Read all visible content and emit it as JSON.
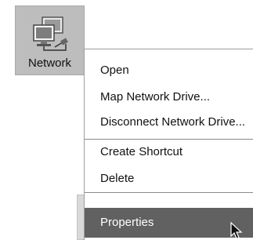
{
  "desktop": {
    "icon": {
      "label": "Network",
      "icon_name": "network-computers-icon"
    }
  },
  "context_menu": {
    "items": [
      {
        "label": "Open"
      },
      {
        "label": "Map Network Drive..."
      },
      {
        "label": "Disconnect Network Drive..."
      },
      {
        "label": "Create Shortcut"
      },
      {
        "label": "Delete"
      },
      {
        "label": "Properties",
        "highlighted": true
      }
    ]
  },
  "colors": {
    "icon_selection": "#bdbdbd",
    "highlight": "#616161",
    "highlight_text": "#ffffff"
  },
  "cursor": {
    "icon_name": "arrow-pointer-icon"
  }
}
